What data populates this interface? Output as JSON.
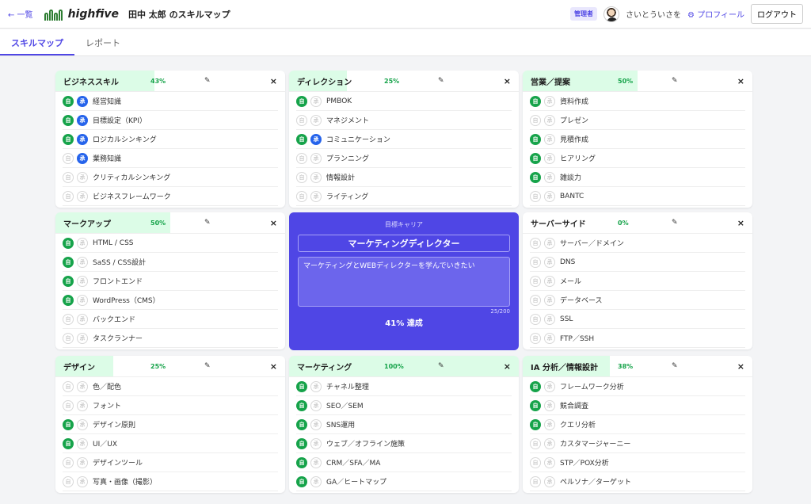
{
  "header": {
    "back": "← 一覧",
    "logo": "highfive",
    "title": "田中 太郎 のスキルマップ",
    "admin_badge": "管理者",
    "username": "さいとういさを",
    "profile": "⚙ プロフィール",
    "logout": "ログアウト"
  },
  "tabs": [
    {
      "label": "スキルマップ",
      "active": true
    },
    {
      "label": "レポート",
      "active": false
    }
  ],
  "chip_labels": {
    "self": "自",
    "approved": "承"
  },
  "colors": {
    "accent": "#4f46e5",
    "self_on": "#16a34a",
    "approved_on": "#2563eb",
    "progress": "#dcfce7"
  },
  "cards": [
    {
      "title": "ビジネススキル",
      "percent": "43%",
      "progress": 43,
      "skills": [
        {
          "name": "経営知識",
          "self": true,
          "approved": true
        },
        {
          "name": "目標設定（KPI）",
          "self": true,
          "approved": true
        },
        {
          "name": "ロジカルシンキング",
          "self": true,
          "approved": true
        },
        {
          "name": "業務知識",
          "self": false,
          "approved": true
        },
        {
          "name": "クリティカルシンキング",
          "self": false,
          "approved": false
        },
        {
          "name": "ビジネスフレームワーク",
          "self": false,
          "approved": false
        }
      ]
    },
    {
      "title": "ディレクション",
      "percent": "25%",
      "progress": 25,
      "skills": [
        {
          "name": "PMBOK",
          "self": true,
          "approved": false
        },
        {
          "name": "マネジメント",
          "self": false,
          "approved": false
        },
        {
          "name": "コミュニケーション",
          "self": true,
          "approved": true
        },
        {
          "name": "プランニング",
          "self": false,
          "approved": false
        },
        {
          "name": "情報設計",
          "self": false,
          "approved": false
        },
        {
          "name": "ライティング",
          "self": false,
          "approved": false
        }
      ]
    },
    {
      "title": "営業／提案",
      "percent": "50%",
      "progress": 50,
      "skills": [
        {
          "name": "資料作成",
          "self": true,
          "approved": false
        },
        {
          "name": "プレゼン",
          "self": false,
          "approved": false
        },
        {
          "name": "見積作成",
          "self": true,
          "approved": false
        },
        {
          "name": "ヒアリング",
          "self": true,
          "approved": false
        },
        {
          "name": "雑談力",
          "self": true,
          "approved": false
        },
        {
          "name": "BANTC",
          "self": false,
          "approved": false
        }
      ]
    },
    {
      "title": "マークアップ",
      "percent": "50%",
      "progress": 50,
      "skills": [
        {
          "name": "HTML / CSS",
          "self": true,
          "approved": false
        },
        {
          "name": "SaSS / CSS設計",
          "self": true,
          "approved": false
        },
        {
          "name": "フロントエンド",
          "self": true,
          "approved": false
        },
        {
          "name": "WordPress（CMS）",
          "self": true,
          "approved": false
        },
        {
          "name": "バックエンド",
          "self": false,
          "approved": false
        },
        {
          "name": "タスクランナー",
          "self": false,
          "approved": false
        }
      ]
    },
    {
      "title": "サーバーサイド",
      "percent": "0%",
      "progress": 0,
      "skills": [
        {
          "name": "サーバー／ドメイン",
          "self": false,
          "approved": false
        },
        {
          "name": "DNS",
          "self": false,
          "approved": false
        },
        {
          "name": "メール",
          "self": false,
          "approved": false
        },
        {
          "name": "データベース",
          "self": false,
          "approved": false
        },
        {
          "name": "SSL",
          "self": false,
          "approved": false
        },
        {
          "name": "FTP／SSH",
          "self": false,
          "approved": false
        }
      ]
    },
    {
      "title": "デザイン",
      "percent": "25%",
      "progress": 25,
      "skills": [
        {
          "name": "色／配色",
          "self": false,
          "approved": false
        },
        {
          "name": "フォント",
          "self": false,
          "approved": false
        },
        {
          "name": "デザイン原則",
          "self": true,
          "approved": false
        },
        {
          "name": "UI／UX",
          "self": true,
          "approved": false
        },
        {
          "name": "デザインツール",
          "self": false,
          "approved": false
        },
        {
          "name": "写真・画像（撮影）",
          "self": false,
          "approved": false
        }
      ]
    },
    {
      "title": "マーケティング",
      "percent": "100%",
      "progress": 100,
      "skills": [
        {
          "name": "チャネル整理",
          "self": true,
          "approved": false
        },
        {
          "name": "SEO／SEM",
          "self": true,
          "approved": false
        },
        {
          "name": "SNS運用",
          "self": true,
          "approved": false
        },
        {
          "name": "ウェブ／オフライン施策",
          "self": true,
          "approved": false
        },
        {
          "name": "CRM／SFA／MA",
          "self": true,
          "approved": false
        },
        {
          "name": "GA／ヒートマップ",
          "self": true,
          "approved": false
        }
      ]
    },
    {
      "title": "IA 分析／情報設計",
      "percent": "38%",
      "progress": 38,
      "skills": [
        {
          "name": "フレームワーク分析",
          "self": true,
          "approved": false
        },
        {
          "name": "競合調査",
          "self": true,
          "approved": false
        },
        {
          "name": "クエリ分析",
          "self": true,
          "approved": false
        },
        {
          "name": "カスタマージャーニー",
          "self": false,
          "approved": false
        },
        {
          "name": "STP／POX分析",
          "self": false,
          "approved": false
        },
        {
          "name": "ペルソナ／ターゲット",
          "self": false,
          "approved": false
        }
      ]
    }
  ],
  "career": {
    "label": "目標キャリア",
    "title": "マーケティングディレクター",
    "description": "マーケティングとWEBディレクターを学んでいきたい",
    "counter": "25/200",
    "progress": "41% 達成"
  }
}
